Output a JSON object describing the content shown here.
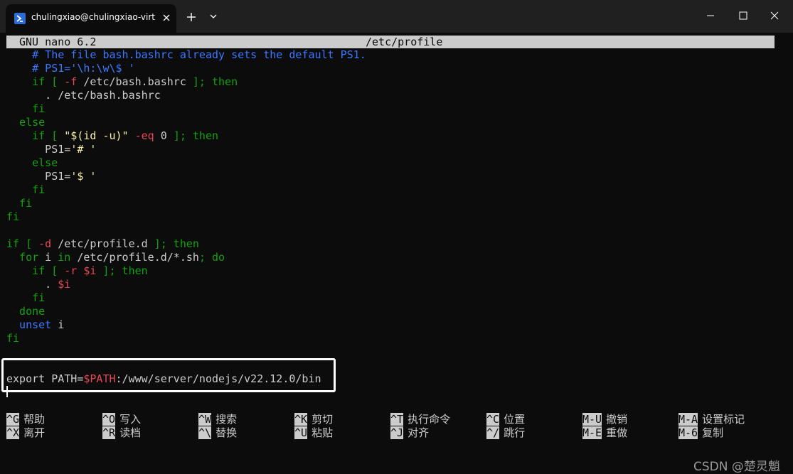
{
  "window": {
    "tab_title": "chulingxiao@chulingxiao-virt",
    "tab_icon": "powershell-icon",
    "new_tab_icon": "plus-icon",
    "dropdown_icon": "chevron-down-icon",
    "controls": [
      "minimize-icon",
      "maximize-icon",
      "close-icon"
    ]
  },
  "nano": {
    "app_name": "GNU nano 6.2",
    "file_name": "/etc/profile"
  },
  "code_lines": [
    [
      {
        "t": "    # The file bash.bashrc already sets the default PS1.",
        "c": "comment"
      }
    ],
    [
      {
        "t": "    # PS1='\\h:\\w\\$ '",
        "c": "comment"
      }
    ],
    [
      {
        "t": "    if",
        "c": "kw"
      },
      {
        "t": " [ ",
        "c": "kw"
      },
      {
        "t": "-f",
        "c": "op"
      },
      {
        "t": " /etc/bash.bashrc ",
        "c": "plain"
      },
      {
        "t": "]; then",
        "c": "kw"
      }
    ],
    [
      {
        "t": "      . /etc/bash.bashrc",
        "c": "plain"
      }
    ],
    [
      {
        "t": "    fi",
        "c": "kw"
      }
    ],
    [
      {
        "t": "  else",
        "c": "kw"
      }
    ],
    [
      {
        "t": "    if",
        "c": "kw"
      },
      {
        "t": " [ ",
        "c": "kw"
      },
      {
        "t": "\"$(id -u)\"",
        "c": "str"
      },
      {
        "t": " -eq",
        "c": "op"
      },
      {
        "t": " 0 ",
        "c": "plain"
      },
      {
        "t": "]; then",
        "c": "kw"
      }
    ],
    [
      {
        "t": "      PS1=",
        "c": "plain"
      },
      {
        "t": "'# '",
        "c": "str"
      }
    ],
    [
      {
        "t": "    else",
        "c": "kw"
      }
    ],
    [
      {
        "t": "      PS1=",
        "c": "plain"
      },
      {
        "t": "'$ '",
        "c": "str"
      }
    ],
    [
      {
        "t": "    fi",
        "c": "kw"
      }
    ],
    [
      {
        "t": "  fi",
        "c": "kw"
      }
    ],
    [
      {
        "t": "fi",
        "c": "kw"
      }
    ],
    [
      {
        "t": "",
        "c": "plain"
      }
    ],
    [
      {
        "t": "if",
        "c": "kw"
      },
      {
        "t": " [ ",
        "c": "kw"
      },
      {
        "t": "-d",
        "c": "op"
      },
      {
        "t": " /etc/profile.d ",
        "c": "plain"
      },
      {
        "t": "]; then",
        "c": "kw"
      }
    ],
    [
      {
        "t": "  for",
        "c": "kw"
      },
      {
        "t": " i ",
        "c": "plain"
      },
      {
        "t": "in",
        "c": "kw"
      },
      {
        "t": " /etc/profile.d/*.sh",
        "c": "plain"
      },
      {
        "t": "; do",
        "c": "kw"
      }
    ],
    [
      {
        "t": "    if",
        "c": "kw"
      },
      {
        "t": " [ ",
        "c": "kw"
      },
      {
        "t": "-r",
        "c": "op"
      },
      {
        "t": " ",
        "c": "plain"
      },
      {
        "t": "$i",
        "c": "var"
      },
      {
        "t": " ]; then",
        "c": "kw"
      }
    ],
    [
      {
        "t": "      . ",
        "c": "plain"
      },
      {
        "t": "$i",
        "c": "var"
      }
    ],
    [
      {
        "t": "    fi",
        "c": "kw"
      }
    ],
    [
      {
        "t": "  done",
        "c": "kw"
      }
    ],
    [
      {
        "t": "  unset",
        "c": "comment"
      },
      {
        "t": " i",
        "c": "plain"
      }
    ],
    [
      {
        "t": "fi",
        "c": "kw"
      }
    ],
    [
      {
        "t": "",
        "c": "plain"
      }
    ],
    [
      {
        "t": "",
        "c": "plain"
      }
    ],
    [
      {
        "t": "export PATH=",
        "c": "plain"
      },
      {
        "t": "$PATH",
        "c": "var"
      },
      {
        "t": ":/www/server/nodejs/v22.12.0/bin",
        "c": "plain"
      }
    ]
  ],
  "shortcuts": [
    {
      "key": "^G",
      "label": "帮助"
    },
    {
      "key": "^O",
      "label": "写入"
    },
    {
      "key": "^W",
      "label": "搜索"
    },
    {
      "key": "^K",
      "label": "剪切"
    },
    {
      "key": "^T",
      "label": "执行命令"
    },
    {
      "key": "^C",
      "label": "位置"
    },
    {
      "key": "M-U",
      "label": "撤销"
    },
    {
      "key": "M-A",
      "label": "设置标记"
    },
    {
      "key": "^X",
      "label": "离开"
    },
    {
      "key": "^R",
      "label": "读档"
    },
    {
      "key": "^\\",
      "label": "替换"
    },
    {
      "key": "^U",
      "label": "粘贴"
    },
    {
      "key": "^J",
      "label": "对齐"
    },
    {
      "key": "^/",
      "label": "跳行"
    },
    {
      "key": "M-E",
      "label": "重做"
    },
    {
      "key": "M-6",
      "label": "复制"
    }
  ],
  "watermark": "CSDN @楚灵魈",
  "colors": {
    "comment": "#3b78ff",
    "keyword": "#13a10e",
    "string": "#f9f1a5",
    "variable": "#e74856",
    "text": "#cccccc",
    "background": "#0c0c0c"
  }
}
